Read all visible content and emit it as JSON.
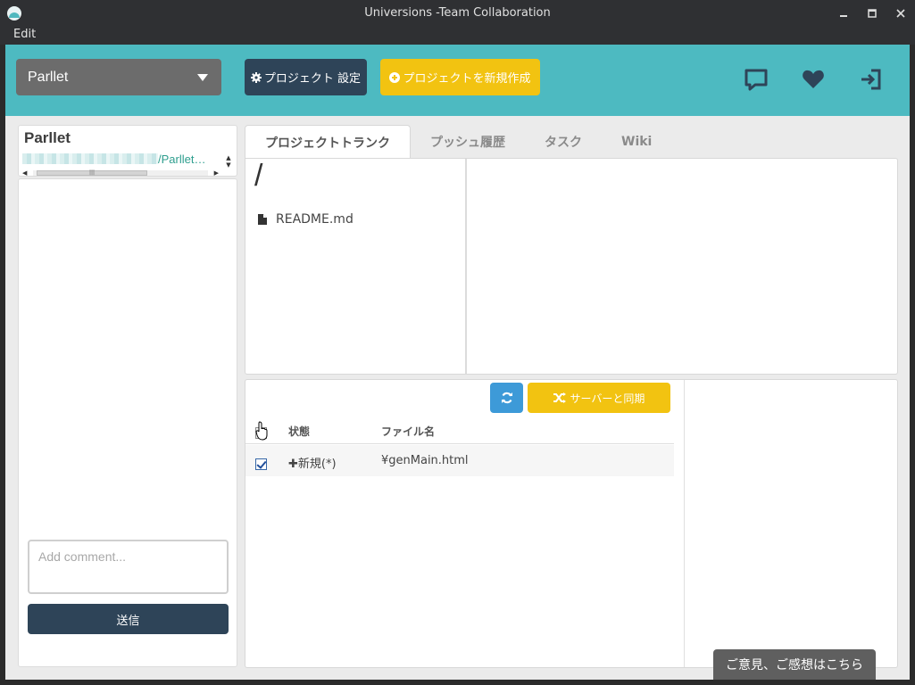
{
  "window": {
    "title": "Universions -Team Collaboration",
    "menu": [
      "Edit"
    ]
  },
  "header": {
    "project_select": "Parllet",
    "settings_button": "プロジェクト 設定",
    "new_project_button": "プロジェクトを新規作成",
    "icons": [
      "chat-icon",
      "heart-icon",
      "sign-in-icon"
    ],
    "accent_color": "#4dbac1"
  },
  "sidebar": {
    "project_name": "Parllet",
    "repo_path_suffix": "/Parllet…",
    "comment_placeholder": "Add comment...",
    "send_button": "送信"
  },
  "tabs": [
    {
      "label": "プロジェクトトランク",
      "active": true
    },
    {
      "label": "プッシュ履歴",
      "active": false
    },
    {
      "label": "タスク",
      "active": false
    },
    {
      "label": "Wiki",
      "active": false
    }
  ],
  "trunk": {
    "path": "/",
    "files": [
      {
        "name": "README.md",
        "icon": "file-icon"
      }
    ]
  },
  "changes": {
    "sync_button": "サーバーと同期",
    "columns": {
      "status": "状態",
      "filename": "ファイル名"
    },
    "rows": [
      {
        "checked": true,
        "status": "✚新規(*)",
        "filename": "¥genMain.html"
      }
    ]
  },
  "feedback_button": "ご意見、ご感想はこちら"
}
